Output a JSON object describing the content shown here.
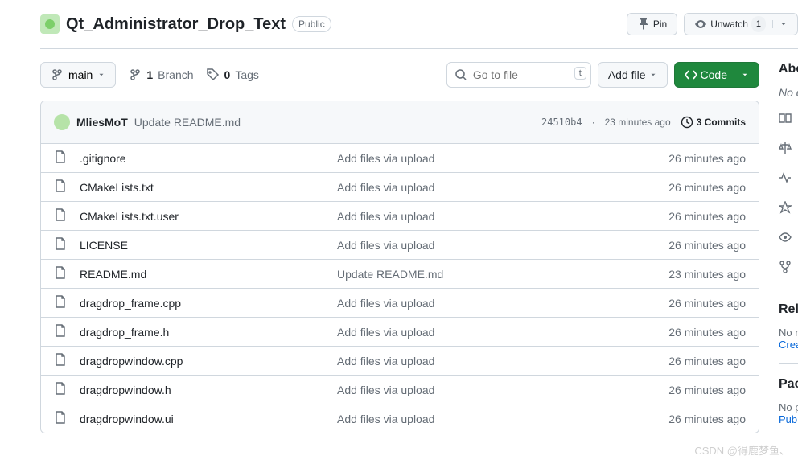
{
  "header": {
    "repo_name": "Qt_Administrator_Drop_Text",
    "visibility": "Public",
    "pin": "Pin",
    "unwatch": "Unwatch",
    "watch_count": "1"
  },
  "toolbar": {
    "branch": "main",
    "branches_count": "1",
    "branches_label": "Branch",
    "tags_count": "0",
    "tags_label": "Tags",
    "search_placeholder": "Go to file",
    "search_kbd": "t",
    "add_file": "Add file",
    "code": "Code"
  },
  "latest": {
    "author": "MliesMoT",
    "message": "Update README.md",
    "sha": "24510b4",
    "time": "23 minutes ago",
    "commits_count": "3 Commits"
  },
  "files": [
    {
      "name": ".gitignore",
      "msg": "Add files via upload",
      "time": "26 minutes ago"
    },
    {
      "name": "CMakeLists.txt",
      "msg": "Add files via upload",
      "time": "26 minutes ago"
    },
    {
      "name": "CMakeLists.txt.user",
      "msg": "Add files via upload",
      "time": "26 minutes ago"
    },
    {
      "name": "LICENSE",
      "msg": "Add files via upload",
      "time": "26 minutes ago"
    },
    {
      "name": "README.md",
      "msg": "Update README.md",
      "time": "23 minutes ago"
    },
    {
      "name": "dragdrop_frame.cpp",
      "msg": "Add files via upload",
      "time": "26 minutes ago"
    },
    {
      "name": "dragdrop_frame.h",
      "msg": "Add files via upload",
      "time": "26 minutes ago"
    },
    {
      "name": "dragdropwindow.cpp",
      "msg": "Add files via upload",
      "time": "26 minutes ago"
    },
    {
      "name": "dragdropwindow.h",
      "msg": "Add files via upload",
      "time": "26 minutes ago"
    },
    {
      "name": "dragdropwindow.ui",
      "msg": "Add files via upload",
      "time": "26 minutes ago"
    }
  ],
  "sidebar": {
    "about": "About",
    "no_desc": "No description, website, or topics provided.",
    "releases": "Releases",
    "no_releases": "No releases published",
    "create_release": "Create a new release",
    "packages": "Packages",
    "no_packages": "No packages published",
    "publish": "Publish your first package"
  },
  "watermark": "CSDN @得鹿梦鱼、"
}
